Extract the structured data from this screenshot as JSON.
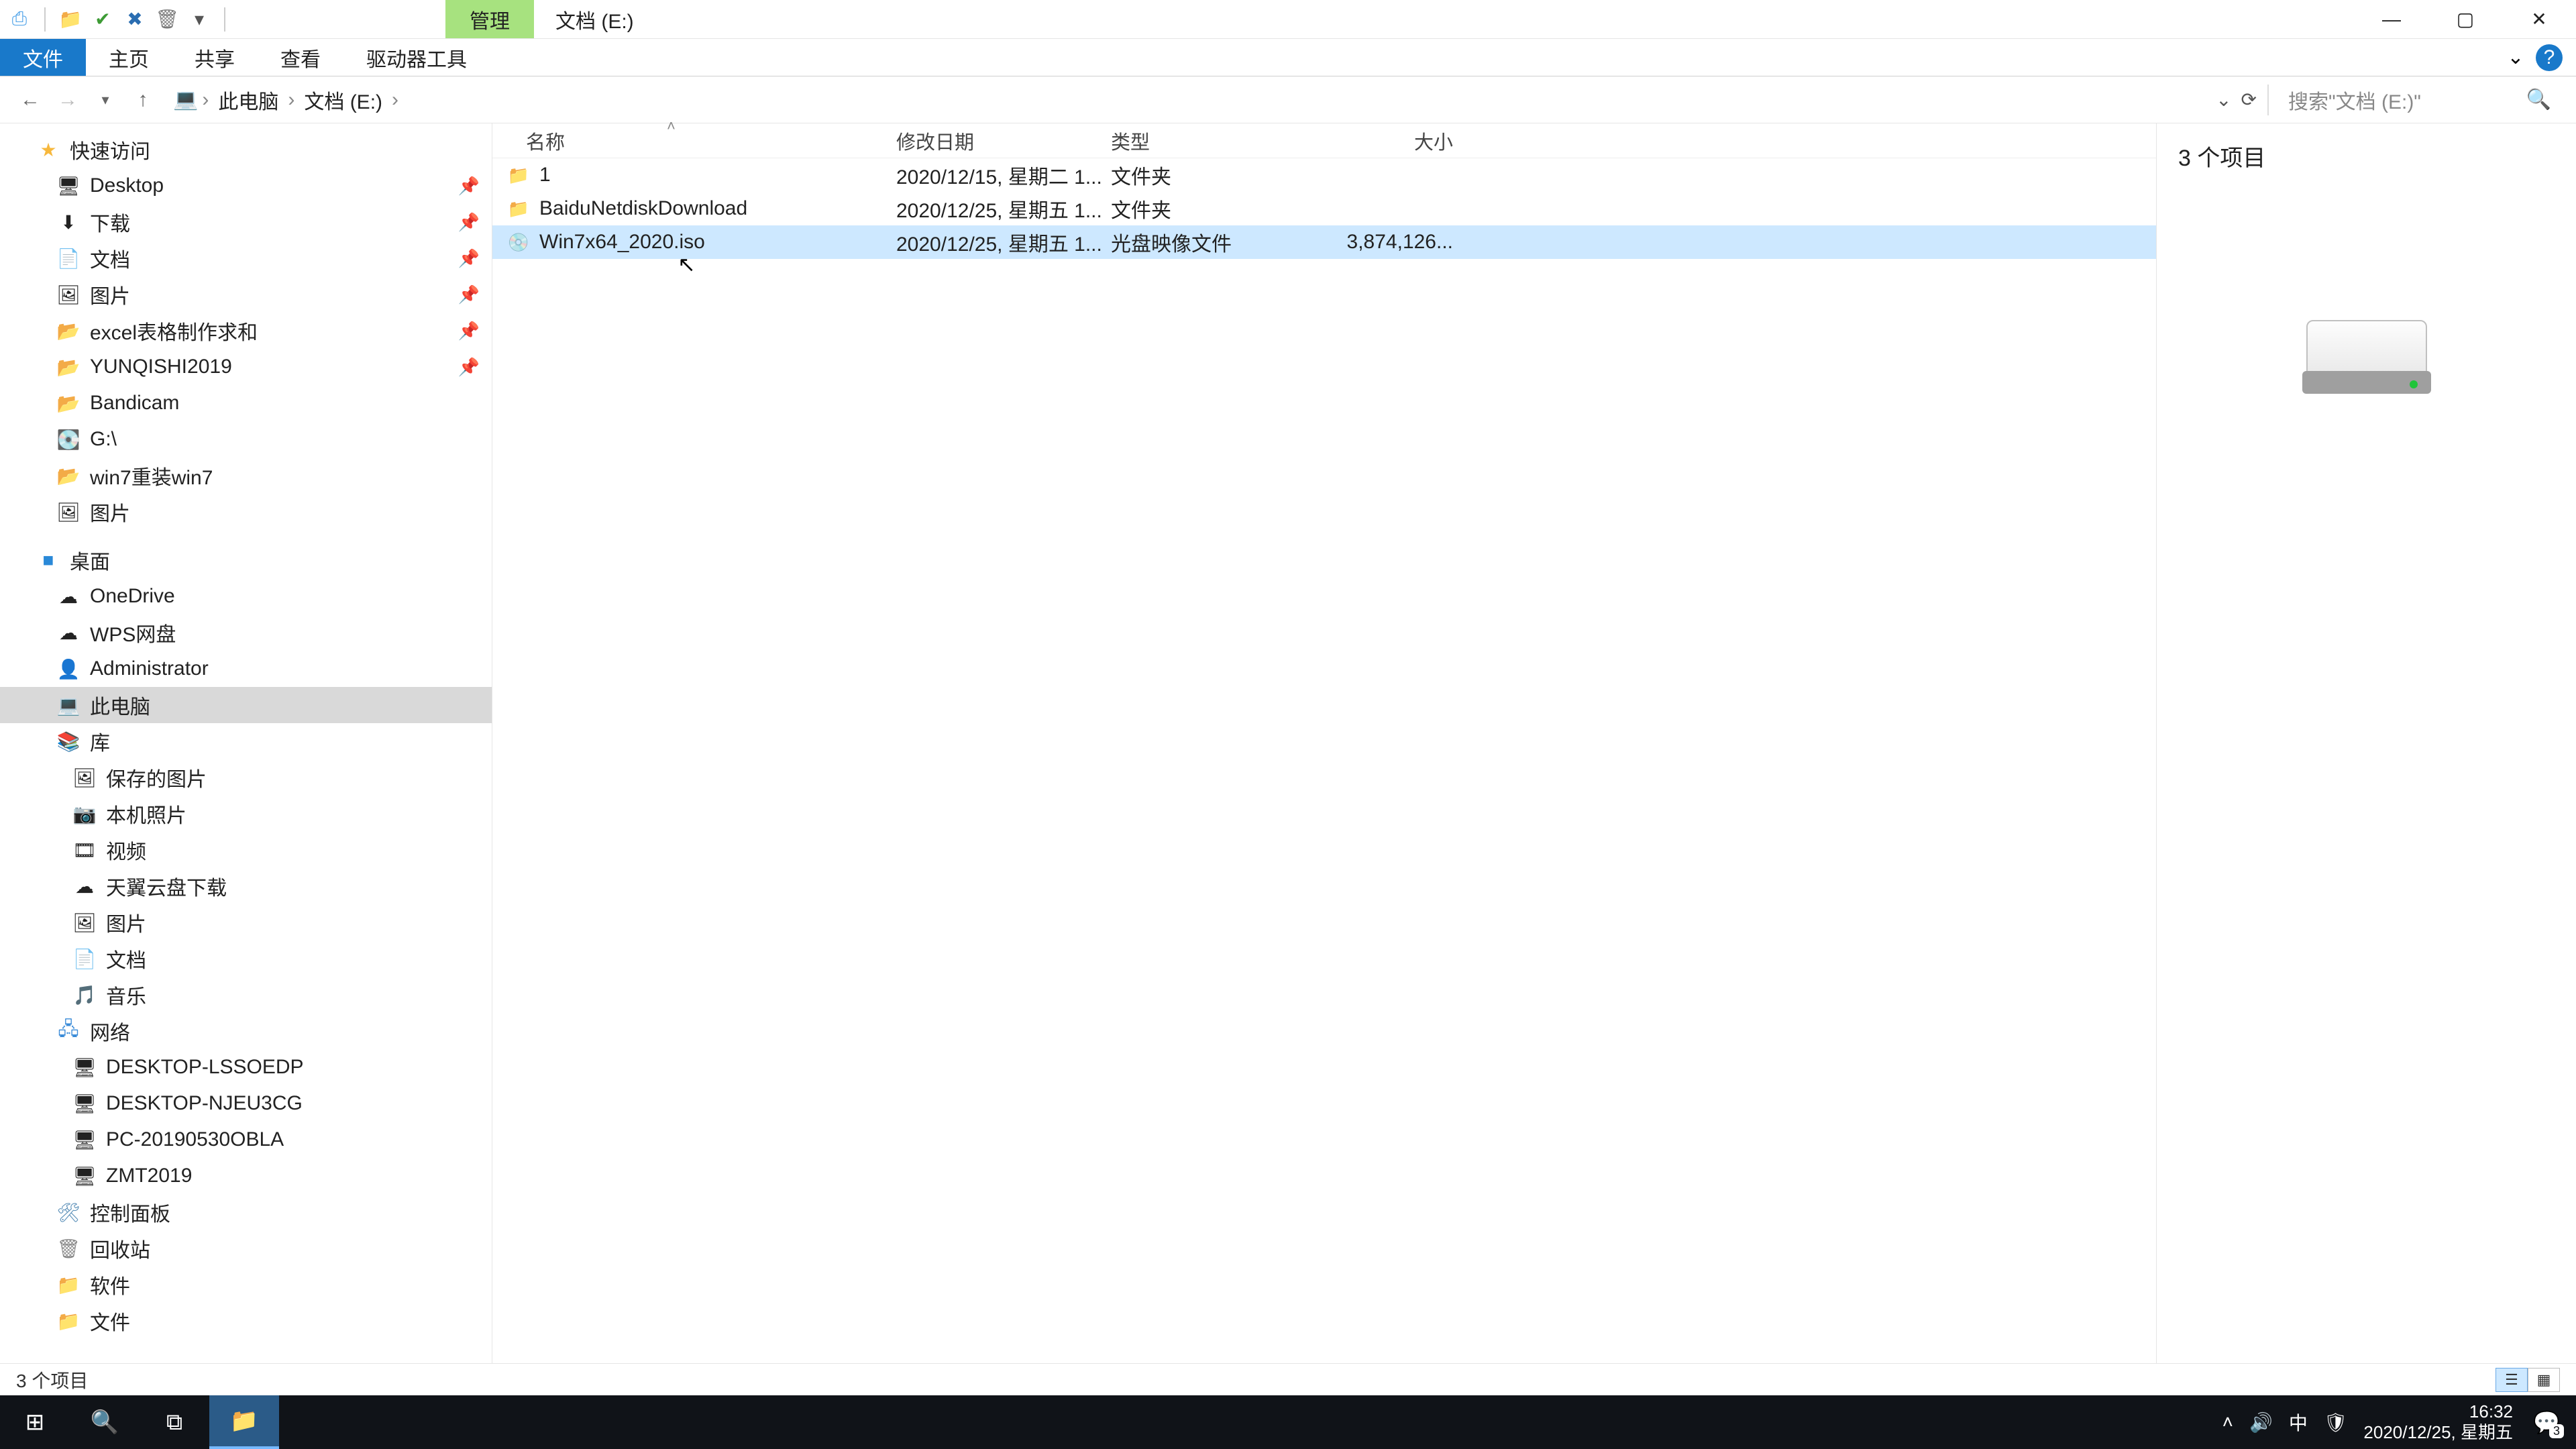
{
  "window": {
    "title": "文档 (E:)",
    "ctx_tab": "管理"
  },
  "ribbon": {
    "file": "文件",
    "home": "主页",
    "share": "共享",
    "view": "查看",
    "drive_tools": "驱动器工具"
  },
  "breadcrumbs": [
    "此电脑",
    "文档 (E:)"
  ],
  "search": {
    "placeholder": "搜索\"文档 (E:)\""
  },
  "nav": {
    "quick_access": "快速访问",
    "qa_items": [
      {
        "icon": "🖥",
        "label": "Desktop",
        "pinned": true
      },
      {
        "icon": "⬇",
        "label": "下载",
        "pinned": true
      },
      {
        "icon": "📄",
        "label": "文档",
        "pinned": true
      },
      {
        "icon": "🖼",
        "label": "图片",
        "pinned": true
      },
      {
        "icon": "📂",
        "label": "excel表格制作求和",
        "pinned": true
      },
      {
        "icon": "📂",
        "label": "YUNQISHI2019",
        "pinned": true
      },
      {
        "icon": "📂",
        "label": "Bandicam",
        "pinned": false
      },
      {
        "icon": "💽",
        "label": "G:\\",
        "pinned": false
      },
      {
        "icon": "📂",
        "label": "win7重装win7",
        "pinned": false
      },
      {
        "icon": "🖼",
        "label": "图片",
        "pinned": false
      }
    ],
    "desktop": "桌面",
    "desktop_items": [
      {
        "icon": "☁",
        "label": "OneDrive"
      },
      {
        "icon": "☁",
        "label": "WPS网盘"
      },
      {
        "icon": "👤",
        "label": "Administrator"
      },
      {
        "icon": "💻",
        "label": "此电脑",
        "selected": true
      },
      {
        "icon": "📚",
        "label": "库"
      }
    ],
    "lib_items": [
      {
        "icon": "🖼",
        "label": "保存的图片"
      },
      {
        "icon": "📷",
        "label": "本机照片"
      },
      {
        "icon": "🎞",
        "label": "视频"
      },
      {
        "icon": "☁",
        "label": "天翼云盘下载"
      },
      {
        "icon": "🖼",
        "label": "图片"
      },
      {
        "icon": "📄",
        "label": "文档"
      },
      {
        "icon": "🎵",
        "label": "音乐"
      }
    ],
    "network": "网络",
    "net_items": [
      {
        "icon": "🖥",
        "label": "DESKTOP-LSSOEDP"
      },
      {
        "icon": "🖥",
        "label": "DESKTOP-NJEU3CG"
      },
      {
        "icon": "🖥",
        "label": "PC-20190530OBLA"
      },
      {
        "icon": "🖥",
        "label": "ZMT2019"
      }
    ],
    "control_panel": "控制面板",
    "recycle": "回收站",
    "software": "软件",
    "file": "文件"
  },
  "columns": {
    "name": "名称",
    "date": "修改日期",
    "type": "类型",
    "size": "大小"
  },
  "files": [
    {
      "icon": "📁",
      "name": "1",
      "date": "2020/12/15, 星期二 1...",
      "type": "文件夹",
      "size": ""
    },
    {
      "icon": "📁",
      "name": "BaiduNetdiskDownload",
      "date": "2020/12/25, 星期五 1...",
      "type": "文件夹",
      "size": ""
    },
    {
      "icon": "💿",
      "name": "Win7x64_2020.iso",
      "date": "2020/12/25, 星期五 1...",
      "type": "光盘映像文件",
      "size": "3,874,126...",
      "selected": true
    }
  ],
  "details": {
    "count": "3 个项目"
  },
  "status": {
    "text": "3 个项目"
  },
  "taskbar": {
    "time": "16:32",
    "date": "2020/12/25, 星期五",
    "ime": "中",
    "notif_count": "3"
  }
}
